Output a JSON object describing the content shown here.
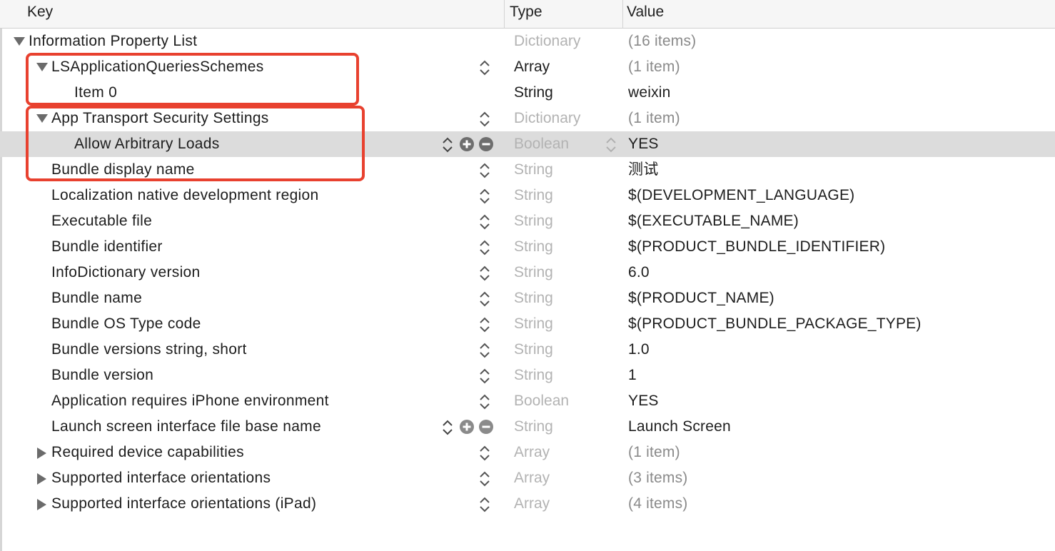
{
  "header": {
    "key_label": "Key",
    "type_label": "Type",
    "value_label": "Value"
  },
  "rows": [
    {
      "key": "Information Property List",
      "type": "Dictionary",
      "value": "(16 items)"
    },
    {
      "key": "LSApplicationQueriesSchemes",
      "type": "Array",
      "value": "(1 item)"
    },
    {
      "key": "Item 0",
      "type": "String",
      "value": "weixin"
    },
    {
      "key": "App Transport Security Settings",
      "type": "Dictionary",
      "value": "(1 item)"
    },
    {
      "key": "Allow Arbitrary Loads",
      "type": "Boolean",
      "value": "YES"
    },
    {
      "key": "Bundle display name",
      "type": "String",
      "value": "测试"
    },
    {
      "key": "Localization native development region",
      "type": "String",
      "value": "$(DEVELOPMENT_LANGUAGE)"
    },
    {
      "key": "Executable file",
      "type": "String",
      "value": "$(EXECUTABLE_NAME)"
    },
    {
      "key": "Bundle identifier",
      "type": "String",
      "value": "$(PRODUCT_BUNDLE_IDENTIFIER)"
    },
    {
      "key": "InfoDictionary version",
      "type": "String",
      "value": "6.0"
    },
    {
      "key": "Bundle name",
      "type": "String",
      "value": "$(PRODUCT_NAME)"
    },
    {
      "key": "Bundle OS Type code",
      "type": "String",
      "value": "$(PRODUCT_BUNDLE_PACKAGE_TYPE)"
    },
    {
      "key": "Bundle versions string, short",
      "type": "String",
      "value": "1.0"
    },
    {
      "key": "Bundle version",
      "type": "String",
      "value": "1"
    },
    {
      "key": "Application requires iPhone environment",
      "type": "Boolean",
      "value": "YES"
    },
    {
      "key": "Launch screen interface file base name",
      "type": "String",
      "value": "Launch Screen"
    },
    {
      "key": "Required device capabilities",
      "type": "Array",
      "value": "(1 item)"
    },
    {
      "key": "Supported interface orientations",
      "type": "Array",
      "value": "(3 items)"
    },
    {
      "key": "Supported interface orientations (iPad)",
      "type": "Array",
      "value": "(4 items)"
    }
  ],
  "colors": {
    "highlight": "#e8412f",
    "selected_row": "#dcdcdc",
    "dim_text": "#b3b3b3"
  },
  "icons": [
    "disclosure-expanded-icon",
    "disclosure-collapsed-icon",
    "type-stepper-icon",
    "add-row-icon",
    "remove-row-icon",
    "value-stepper-icon"
  ]
}
